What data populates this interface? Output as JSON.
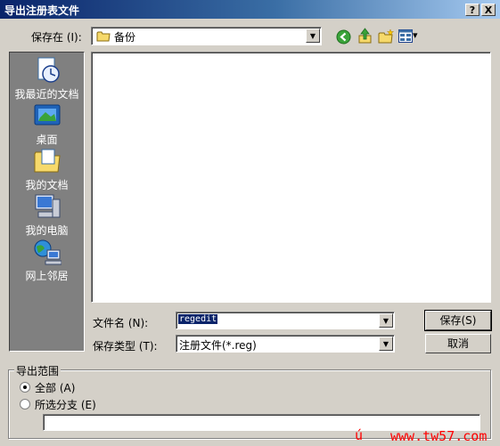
{
  "window": {
    "title": "导出注册表文件",
    "help_label": "?",
    "close_label": "X"
  },
  "toolbar": {
    "save_in_label": "保存在 (I):",
    "location": "备份",
    "combo_arrow": "▼",
    "view_menu_arrow": "▾"
  },
  "places": [
    {
      "label": "我最近的文档",
      "icon": "recent-documents-icon"
    },
    {
      "label": "桌面",
      "icon": "desktop-icon"
    },
    {
      "label": "我的文档",
      "icon": "my-documents-icon"
    },
    {
      "label": "我的电脑",
      "icon": "my-computer-icon"
    },
    {
      "label": "网上邻居",
      "icon": "network-places-icon"
    }
  ],
  "file_name": {
    "label": "文件名 (N):",
    "value": "regedit"
  },
  "file_type": {
    "label": "保存类型 (T):",
    "value": "注册文件(*.reg)"
  },
  "buttons": {
    "save": "保存(S)",
    "cancel": "取消"
  },
  "export_range": {
    "title": "导出范围",
    "options": [
      {
        "label": "全部 (A)",
        "selected": true
      },
      {
        "label": "所选分支 (E)",
        "selected": false
      }
    ],
    "branch_value": ""
  },
  "watermark": {
    "glyph": "ú",
    "text": "www.tw57.com"
  },
  "colors": {
    "title_start": "#0a246a",
    "title_end": "#a6caf0",
    "face": "#d4d0c8",
    "places_bg": "#808080",
    "watermark": "#ff0000"
  }
}
